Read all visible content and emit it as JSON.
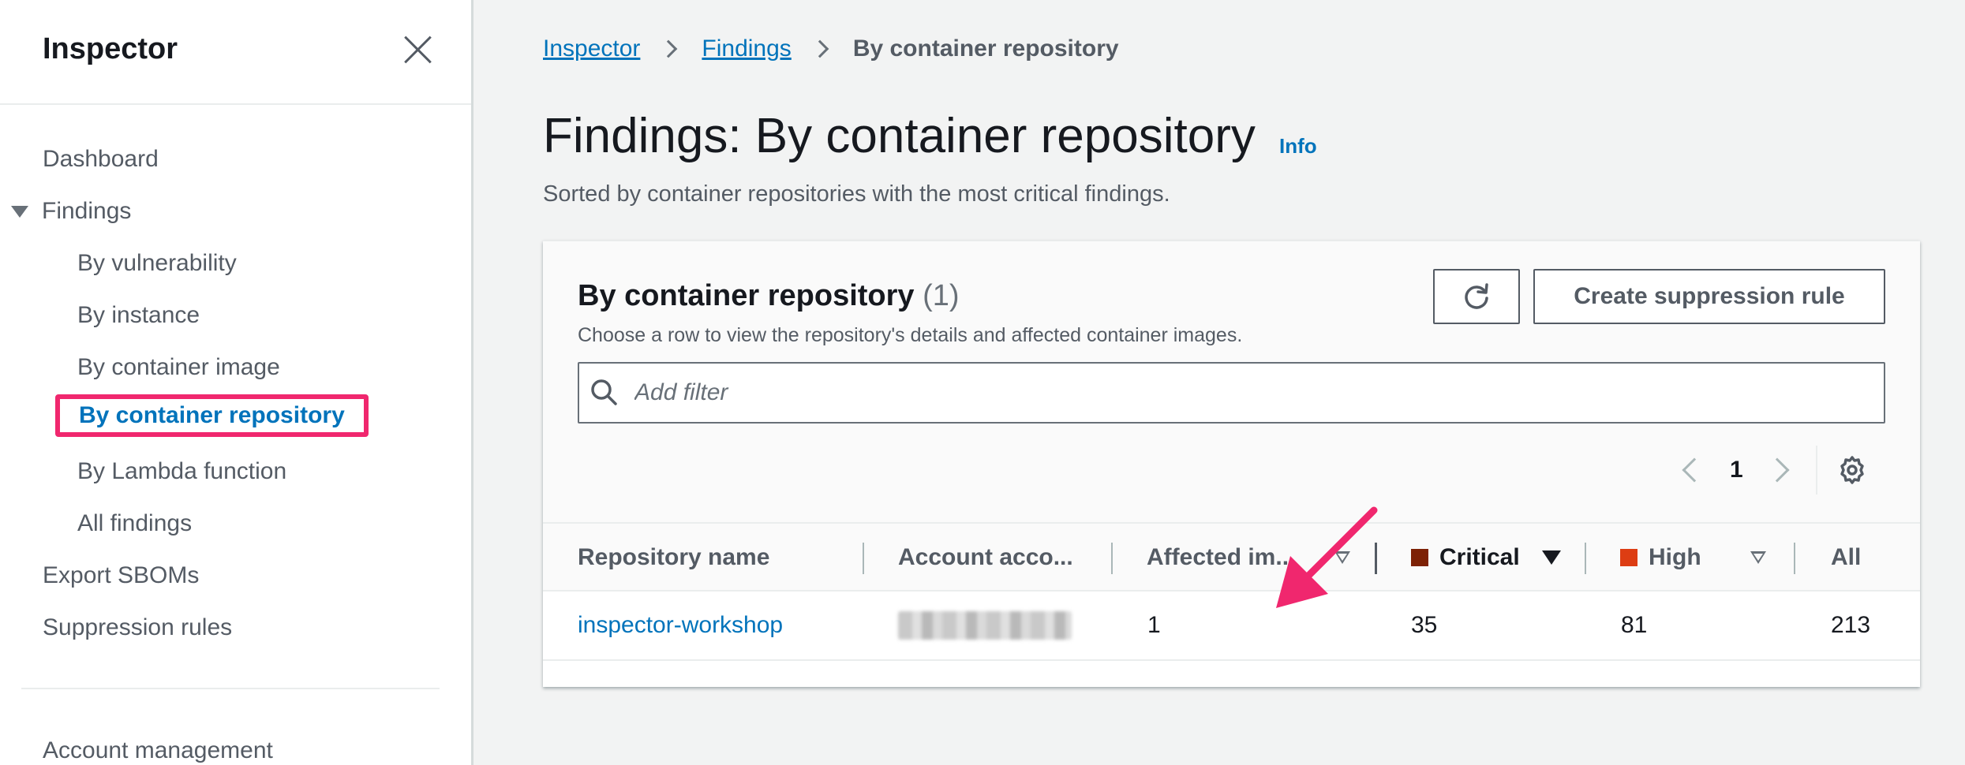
{
  "sidebar": {
    "title": "Inspector",
    "items": {
      "dashboard": "Dashboard",
      "findings": "Findings",
      "by_vulnerability": "By vulnerability",
      "by_instance": "By instance",
      "by_container_image": "By container image",
      "by_container_repository": "By container repository",
      "by_lambda_function": "By Lambda function",
      "all_findings": "All findings",
      "export_sboms": "Export SBOMs",
      "suppression_rules": "Suppression rules",
      "account_management": "Account management"
    },
    "active_item": "By container repository"
  },
  "breadcrumb": {
    "items": [
      "Inspector",
      "Findings",
      "By container repository"
    ]
  },
  "page": {
    "title": "Findings: By container repository",
    "info": "Info",
    "subtitle": "Sorted by container repositories with the most critical findings."
  },
  "table": {
    "title": "By container repository",
    "count": "(1)",
    "description": "Choose a row to view the repository's details and affected container images.",
    "create_button": "Create suppression rule",
    "filter_placeholder": "Add filter",
    "page_number": "1",
    "columns": {
      "repo": "Repository name",
      "account": "Account acco...",
      "affected": "Affected im...",
      "critical": "Critical",
      "high": "High",
      "all": "All"
    },
    "rows": [
      {
        "repository": "inspector-workshop",
        "affected_images": "1",
        "critical": "35",
        "high": "81",
        "all": "213"
      }
    ]
  },
  "colors": {
    "link": "#0073bb",
    "critical": "#7d2105",
    "high": "#dd3d13",
    "highlight_box": "#f0276e",
    "annotation_arrow": "#f0276e"
  },
  "icons": [
    "close-icon",
    "caret-down-icon",
    "chevron-right-icon",
    "refresh-icon",
    "search-icon",
    "chevron-left-icon",
    "gear-icon",
    "sort-icon",
    "arrow-annotation-icon"
  ]
}
